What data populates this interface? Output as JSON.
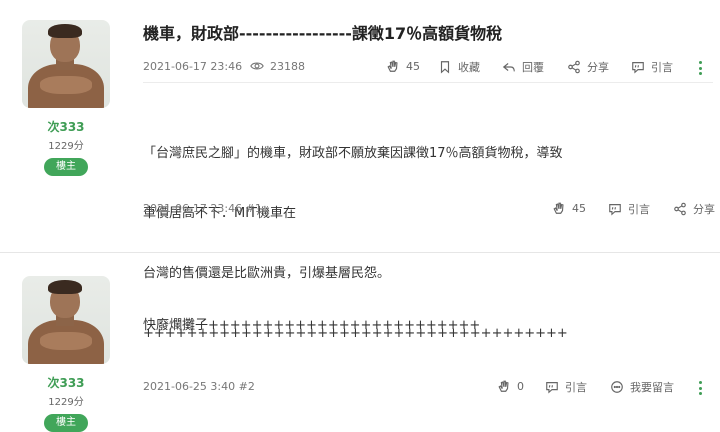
{
  "post1": {
    "author": {
      "name": "次333",
      "score": "1229分",
      "badge": "樓主"
    },
    "title": "機車，財政部-----------------課徵17％高額貨物稅",
    "date": "2021-06-17 23:46",
    "views": "23188",
    "actions": {
      "likes": "45",
      "bookmark": "收藏",
      "reply": "回覆",
      "share": "分享",
      "quote": "引言"
    },
    "content_lines": [
      "「台灣庶民之腳」的機車，財政部不願放棄因課徵17％高額貨物稅，導致",
      "車價居高不下．MIT機車在",
      "台灣的售價還是比歐洲貴，引爆基層民怨。",
      "+++++++++++++++++++++++++++++++++++++++"
    ],
    "footer": {
      "date_floor": "2021-06-17 23:46 #1",
      "likes": "45",
      "quote": "引言",
      "share": "分享"
    }
  },
  "post2": {
    "author": {
      "name": "次333",
      "score": "1229分",
      "badge": "樓主"
    },
    "content_lines": [
      "快廢爛攤子+++++++++++++++++++++++++"
    ],
    "footer": {
      "date_floor": "2021-06-25 3:40 #2",
      "likes": "0",
      "quote": "引言",
      "comment": "我要留言"
    }
  }
}
